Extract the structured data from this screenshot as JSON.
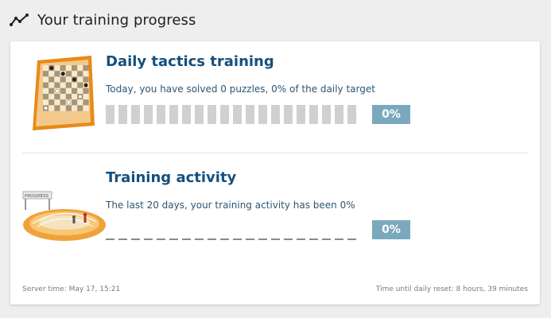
{
  "header": {
    "title": "Your training progress"
  },
  "tactics": {
    "title": "Daily tactics training",
    "description": "Today, you have solved 0 puzzles, 0% of the daily target",
    "percent_label": "0%",
    "progress": 0,
    "segments": 20
  },
  "activity": {
    "title": "Training activity",
    "description": "The last 20 days, your training activity has been 0%",
    "percent_label": "0%",
    "progress": 0,
    "days": 20
  },
  "footer": {
    "server_time": "Server time: May 17, 15:21",
    "reset_time": "Time until daily reset: 8 hours, 39 minutes"
  },
  "colors": {
    "title_blue": "#14507f",
    "badge": "#7aa9bd",
    "segment_empty": "#d0d0d0",
    "board_border": "#e88a1a"
  },
  "icons": {
    "header": "line-chart-icon",
    "tactics": "chessboard-icon",
    "activity": "race-track-icon"
  }
}
